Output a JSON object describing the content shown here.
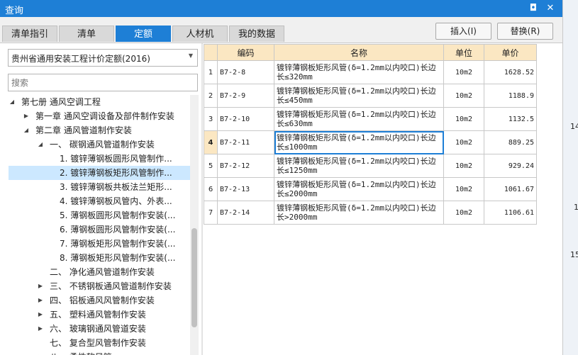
{
  "window": {
    "title": "查询",
    "restore_glyph": "◘",
    "close_glyph": "✕"
  },
  "tabs": [
    {
      "label": "清单指引",
      "active": false
    },
    {
      "label": "清单",
      "active": false
    },
    {
      "label": "定额",
      "active": true
    },
    {
      "label": "人材机",
      "active": false
    },
    {
      "label": "我的数据",
      "active": false
    }
  ],
  "buttons": {
    "insert": "插入(I)",
    "replace": "替换(R)"
  },
  "left": {
    "dropdown_value": "贵州省通用安装工程计价定额(2016)",
    "search_placeholder": "搜索",
    "tree": [
      {
        "label": "第七册 通风空调工程",
        "toggle": "◢",
        "indent": 0
      },
      {
        "label": "第一章 通风空调设备及部件制作安装",
        "toggle": "▶",
        "indent": 1
      },
      {
        "label": "第二章 通风管道制作安装",
        "toggle": "◢",
        "indent": 1
      },
      {
        "label": "一、 碳钢通风管道制作安装",
        "toggle": "◢",
        "indent": 2
      },
      {
        "label": "1. 镀锌薄钢板圆形风管制作...",
        "toggle": "",
        "indent": 3
      },
      {
        "label": "2. 镀锌薄钢板矩形风管制作...",
        "toggle": "",
        "indent": 3,
        "selected": true
      },
      {
        "label": "3. 镀锌薄钢板共板法兰矩形...",
        "toggle": "",
        "indent": 3
      },
      {
        "label": "4. 镀锌薄钢板风管内、外表...",
        "toggle": "",
        "indent": 3
      },
      {
        "label": "5. 薄钢板圆形风管制作安装(...",
        "toggle": "",
        "indent": 3
      },
      {
        "label": "6. 薄钢板圆形风管制作安装(...",
        "toggle": "",
        "indent": 3
      },
      {
        "label": "7. 薄钢板矩形风管制作安装(...",
        "toggle": "",
        "indent": 3
      },
      {
        "label": "8. 薄钢板矩形风管制作安装(...",
        "toggle": "",
        "indent": 3
      },
      {
        "label": "二、 净化通风管道制作安装",
        "toggle": "",
        "indent": 2
      },
      {
        "label": "三、 不锈钢板通风管道制作安装",
        "toggle": "▶",
        "indent": 2
      },
      {
        "label": "四、 铝板通风风管制作安装",
        "toggle": "▶",
        "indent": 2
      },
      {
        "label": "五、 塑料通风管制作安装",
        "toggle": "▶",
        "indent": 2
      },
      {
        "label": "六、 玻璃钢通风管道安装",
        "toggle": "▶",
        "indent": 2
      },
      {
        "label": "七、 复合型风管制作安装",
        "toggle": "",
        "indent": 2
      },
      {
        "label": "八、 柔性软风管",
        "toggle": "▶",
        "indent": 2
      }
    ]
  },
  "table": {
    "headers": {
      "code": "编码",
      "name": "名称",
      "unit": "单位",
      "price": "单价"
    },
    "rows": [
      {
        "n": "1",
        "code": "B7-2-8",
        "name": "镀锌薄钢板矩形风管(δ=1.2mm以内咬口)长边长≤320mm",
        "unit": "10m2",
        "price": "1628.52"
      },
      {
        "n": "2",
        "code": "B7-2-9",
        "name": "镀锌薄钢板矩形风管(δ=1.2mm以内咬口)长边长≤450mm",
        "unit": "10m2",
        "price": "1188.9"
      },
      {
        "n": "3",
        "code": "B7-2-10",
        "name": "镀锌薄钢板矩形风管(δ=1.2mm以内咬口)长边长≤630mm",
        "unit": "10m2",
        "price": "1132.5"
      },
      {
        "n": "4",
        "code": "B7-2-11",
        "name": "镀锌薄钢板矩形风管(δ=1.2mm以内咬口)长边长≤1000mm",
        "unit": "10m2",
        "price": "889.25",
        "current": true
      },
      {
        "n": "5",
        "code": "B7-2-12",
        "name": "镀锌薄钢板矩形风管(δ=1.2mm以内咬口)长边长≤1250mm",
        "unit": "10m2",
        "price": "929.24"
      },
      {
        "n": "6",
        "code": "B7-2-13",
        "name": "镀锌薄钢板矩形风管(δ=1.2mm以内咬口)长边长≤2000mm",
        "unit": "10m2",
        "price": "1061.67"
      },
      {
        "n": "7",
        "code": "B7-2-14",
        "name": "镀锌薄钢板矩形风管(δ=1.2mm以内咬口)长边长>2000mm",
        "unit": "10m2",
        "price": "1106.61"
      }
    ]
  },
  "right_strip": [
    "14",
    "1",
    "15"
  ]
}
